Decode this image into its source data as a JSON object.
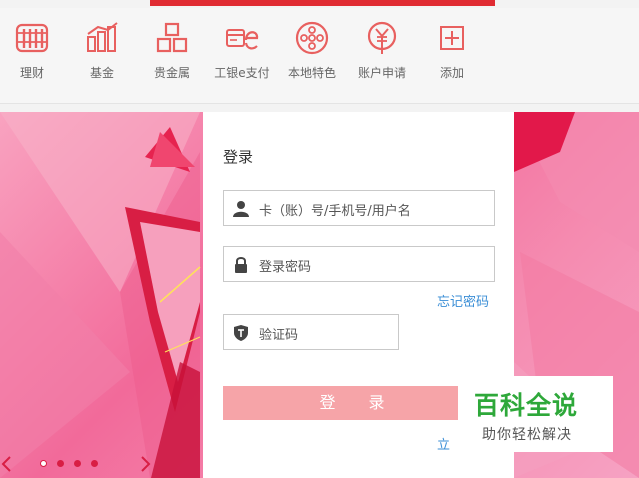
{
  "nav": {
    "items": [
      {
        "label": "理财",
        "icon": "abacus-icon"
      },
      {
        "label": "基金",
        "icon": "bar-chart-icon"
      },
      {
        "label": "贵金属",
        "icon": "gold-bars-icon"
      },
      {
        "label": "工银e支付",
        "icon": "epay-icon"
      },
      {
        "label": "本地特色",
        "icon": "film-reel-icon"
      },
      {
        "label": "账户申请",
        "icon": "yen-icon"
      },
      {
        "label": "添加",
        "icon": "plus-square-icon"
      }
    ],
    "icon_color": "#e8605f"
  },
  "login": {
    "title": "登录",
    "account_placeholder": "卡（账）号/手机号/用户名",
    "password_placeholder": "登录密码",
    "forgot_label": "忘记密码",
    "captcha_placeholder": "验证码",
    "login_button": "登 录",
    "register_partial": "立"
  },
  "banner": {
    "dots": 4,
    "active_dot": 0
  },
  "watermark": {
    "title": "百科全说",
    "subtitle": "助你轻松解决"
  },
  "colors": {
    "accent_red": "#e02b32",
    "login_button": "#f6a4a8",
    "link_blue": "#3a8ed6",
    "watermark_green": "#2ea83a"
  }
}
